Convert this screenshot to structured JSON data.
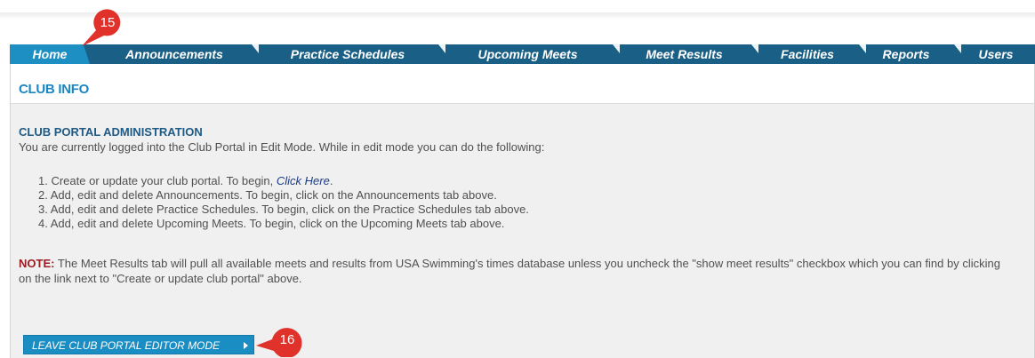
{
  "tabs": [
    {
      "label": "Home",
      "active": true
    },
    {
      "label": "Announcements"
    },
    {
      "label": "Practice Schedules"
    },
    {
      "label": "Upcoming Meets"
    },
    {
      "label": "Meet Results"
    },
    {
      "label": "Facilities"
    },
    {
      "label": "Reports"
    },
    {
      "label": "Users"
    }
  ],
  "section": {
    "title": "CLUB INFO"
  },
  "admin": {
    "title": "CLUB PORTAL ADMINISTRATION",
    "intro": "You are currently logged into the Club Portal in Edit Mode. While in edit mode you can do the following:",
    "steps": [
      {
        "num": "1.",
        "text": "Create or update your club portal. To begin, ",
        "link": "Click Here",
        "after": "."
      },
      {
        "num": "2.",
        "text": "Add, edit and delete Announcements. To begin, click on the Announcements tab above."
      },
      {
        "num": "3.",
        "text": "Add, edit and delete Practice Schedules. To begin, click on the Practice Schedules tab above."
      },
      {
        "num": "4.",
        "text": "Add, edit and delete Upcoming Meets. To begin, click on the Upcoming Meets tab above."
      }
    ],
    "note_label": "NOTE:",
    "note_text": " The Meet Results tab will pull all available meets and results from USA Swimming's times database unless you uncheck the \"show meet results\" checkbox which you can find by clicking on the link next to \"Create or update club portal\" above."
  },
  "leave_button": {
    "label": "LEAVE CLUB PORTAL EDITOR MODE"
  },
  "callouts": [
    {
      "label": "15"
    },
    {
      "label": "16"
    }
  ],
  "colors": {
    "tab_bar": "#1a5f86",
    "tab_active": "#1d8fc3",
    "callout": "#e0312b",
    "note_label": "#9c1c24"
  }
}
